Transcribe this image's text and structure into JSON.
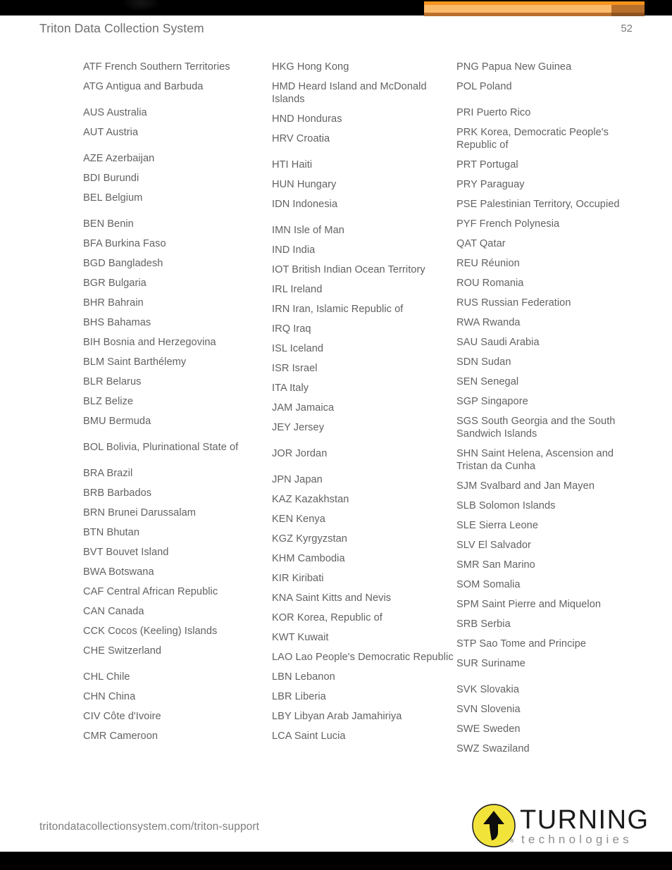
{
  "header": {
    "title": "Triton Data Collection System",
    "page_number": "52"
  },
  "footer": {
    "url": "tritondatacollectionsystem.com/triton-support",
    "logo": {
      "mark_icon": "yellow-circle-arrow-icon",
      "wordmark": "TURNING",
      "subtitle": "technologies",
      "registered_mark": "®",
      "circle_color": "#f2e33a",
      "arrow_color": "#0d0d0d"
    }
  },
  "theme": {
    "band_color": "#000000",
    "ribbon_light": "#fbb96a",
    "ribbon_mid": "#f7941e",
    "ribbon_dark": "#b9702c",
    "text_color": "#626262",
    "page_background": "#ffffff"
  },
  "columns": [
    {
      "name": "column-1",
      "entries": [
        {
          "text": "ATF French Southern Territories",
          "spacing": "normal"
        },
        {
          "text": "ATG Antigua and Barbuda",
          "spacing": "wrap"
        },
        {
          "text": "AUS Australia",
          "spacing": "normal"
        },
        {
          "text": "AUT Austria",
          "spacing": "wrap"
        },
        {
          "text": "AZE Azerbaijan",
          "spacing": "normal"
        },
        {
          "text": "BDI Burundi",
          "spacing": "normal"
        },
        {
          "text": "BEL Belgium",
          "spacing": "wrap"
        },
        {
          "text": "BEN Benin",
          "spacing": "normal"
        },
        {
          "text": "BFA Burkina Faso",
          "spacing": "normal"
        },
        {
          "text": "BGD Bangladesh",
          "spacing": "normal"
        },
        {
          "text": "BGR Bulgaria",
          "spacing": "normal"
        },
        {
          "text": "BHR Bahrain",
          "spacing": "normal"
        },
        {
          "text": "BHS Bahamas",
          "spacing": "normal"
        },
        {
          "text": "BIH Bosnia and Herzegovina",
          "spacing": "normal"
        },
        {
          "text": "BLM Saint Barthélemy",
          "spacing": "normal"
        },
        {
          "text": "BLR Belarus",
          "spacing": "normal"
        },
        {
          "text": "BLZ Belize",
          "spacing": "normal"
        },
        {
          "text": "BMU Bermuda",
          "spacing": "wrap"
        },
        {
          "text": "BOL Bolivia, Plurinational State of",
          "spacing": "wrap"
        },
        {
          "text": "BRA Brazil",
          "spacing": "normal"
        },
        {
          "text": "BRB Barbados",
          "spacing": "normal"
        },
        {
          "text": "BRN Brunei Darussalam",
          "spacing": "normal"
        },
        {
          "text": "BTN Bhutan",
          "spacing": "normal"
        },
        {
          "text": "BVT Bouvet Island",
          "spacing": "normal"
        },
        {
          "text": "BWA Botswana",
          "spacing": "normal"
        },
        {
          "text": "CAF Central African Republic",
          "spacing": "normal"
        },
        {
          "text": "CAN Canada",
          "spacing": "normal"
        },
        {
          "text": "CCK Cocos (Keeling) Islands",
          "spacing": "normal"
        },
        {
          "text": "CHE Switzerland",
          "spacing": "wrap"
        },
        {
          "text": "CHL Chile",
          "spacing": "normal"
        },
        {
          "text": "CHN China",
          "spacing": "normal"
        },
        {
          "text": "CIV Côte d'Ivoire",
          "spacing": "normal"
        },
        {
          "text": "CMR Cameroon",
          "spacing": "normal"
        }
      ]
    },
    {
      "name": "column-2",
      "entries": [
        {
          "text": "HKG Hong Kong",
          "spacing": "normal"
        },
        {
          "text": "HMD Heard Island and McDonald Islands",
          "spacing": "normal"
        },
        {
          "text": "HND Honduras",
          "spacing": "normal"
        },
        {
          "text": "HRV Croatia",
          "spacing": "wrap"
        },
        {
          "text": "HTI Haiti",
          "spacing": "normal"
        },
        {
          "text": "HUN Hungary",
          "spacing": "normal"
        },
        {
          "text": "IDN Indonesia",
          "spacing": "wrap"
        },
        {
          "text": "IMN Isle of Man",
          "spacing": "normal"
        },
        {
          "text": "IND India",
          "spacing": "normal"
        },
        {
          "text": "IOT British Indian Ocean Territory",
          "spacing": "normal"
        },
        {
          "text": "IRL Ireland",
          "spacing": "normal"
        },
        {
          "text": "IRN Iran, Islamic Republic of",
          "spacing": "normal"
        },
        {
          "text": "IRQ Iraq",
          "spacing": "normal"
        },
        {
          "text": "ISL Iceland",
          "spacing": "normal"
        },
        {
          "text": "ISR Israel",
          "spacing": "normal"
        },
        {
          "text": "ITA Italy",
          "spacing": "normal"
        },
        {
          "text": "JAM Jamaica",
          "spacing": "normal"
        },
        {
          "text": "JEY Jersey",
          "spacing": "wrap"
        },
        {
          "text": "JOR Jordan",
          "spacing": "wrap"
        },
        {
          "text": "JPN Japan",
          "spacing": "normal"
        },
        {
          "text": "KAZ Kazakhstan",
          "spacing": "normal"
        },
        {
          "text": "KEN Kenya",
          "spacing": "normal"
        },
        {
          "text": "KGZ Kyrgyzstan",
          "spacing": "normal"
        },
        {
          "text": "KHM Cambodia",
          "spacing": "normal"
        },
        {
          "text": "KIR Kiribati",
          "spacing": "normal"
        },
        {
          "text": "KNA Saint Kitts and Nevis",
          "spacing": "normal"
        },
        {
          "text": "KOR Korea, Republic of",
          "spacing": "normal"
        },
        {
          "text": "KWT Kuwait",
          "spacing": "normal"
        },
        {
          "text": "LAO Lao People's Democratic Republic",
          "spacing": "normal"
        },
        {
          "text": "LBN Lebanon",
          "spacing": "normal"
        },
        {
          "text": "LBR Liberia",
          "spacing": "normal"
        },
        {
          "text": "LBY Libyan Arab Jamahiriya",
          "spacing": "normal"
        },
        {
          "text": "LCA Saint Lucia",
          "spacing": "normal"
        }
      ]
    },
    {
      "name": "column-3",
      "entries": [
        {
          "text": "PNG Papua New Guinea",
          "spacing": "normal"
        },
        {
          "text": "POL Poland",
          "spacing": "wrap"
        },
        {
          "text": "PRI Puerto Rico",
          "spacing": "normal"
        },
        {
          "text": "PRK Korea, Democratic People's Republic of",
          "spacing": "normal"
        },
        {
          "text": "PRT Portugal",
          "spacing": "normal"
        },
        {
          "text": "PRY Paraguay",
          "spacing": "normal"
        },
        {
          "text": "PSE Palestinian Territory, Occupied",
          "spacing": "normal"
        },
        {
          "text": "PYF French Polynesia",
          "spacing": "normal"
        },
        {
          "text": "QAT Qatar",
          "spacing": "normal"
        },
        {
          "text": "REU Réunion",
          "spacing": "normal"
        },
        {
          "text": "ROU Romania",
          "spacing": "normal"
        },
        {
          "text": "RUS Russian Federation",
          "spacing": "normal"
        },
        {
          "text": "RWA Rwanda",
          "spacing": "normal"
        },
        {
          "text": "SAU Saudi Arabia",
          "spacing": "normal"
        },
        {
          "text": "SDN Sudan",
          "spacing": "normal"
        },
        {
          "text": "SEN Senegal",
          "spacing": "normal"
        },
        {
          "text": "SGP Singapore",
          "spacing": "normal"
        },
        {
          "text": "SGS South Georgia and the South Sandwich Islands",
          "spacing": "normal"
        },
        {
          "text": "SHN Saint Helena, Ascension and Tristan da Cunha",
          "spacing": "normal"
        },
        {
          "text": "SJM Svalbard and Jan Mayen",
          "spacing": "normal"
        },
        {
          "text": "SLB Solomon Islands",
          "spacing": "normal"
        },
        {
          "text": "SLE Sierra Leone",
          "spacing": "normal"
        },
        {
          "text": "SLV El Salvador",
          "spacing": "normal"
        },
        {
          "text": "SMR San Marino",
          "spacing": "normal"
        },
        {
          "text": "SOM Somalia",
          "spacing": "normal"
        },
        {
          "text": "SPM Saint Pierre and Miquelon",
          "spacing": "normal"
        },
        {
          "text": "SRB Serbia",
          "spacing": "normal"
        },
        {
          "text": "STP Sao Tome and Principe",
          "spacing": "normal"
        },
        {
          "text": "SUR Suriname",
          "spacing": "wrap"
        },
        {
          "text": "SVK Slovakia",
          "spacing": "normal"
        },
        {
          "text": "SVN Slovenia",
          "spacing": "normal"
        },
        {
          "text": "SWE Sweden",
          "spacing": "normal"
        },
        {
          "text": "SWZ Swaziland",
          "spacing": "normal"
        }
      ]
    }
  ]
}
